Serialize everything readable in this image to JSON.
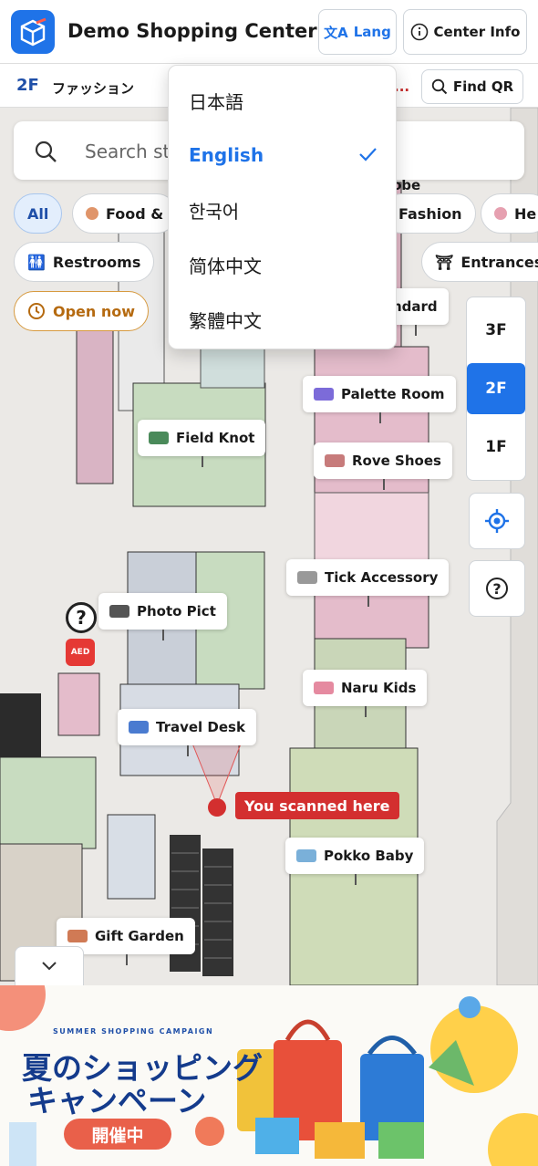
{
  "header": {
    "title": "Demo Shopping Center",
    "lang_label": "Lang",
    "center_info_label": "Center Info"
  },
  "floorbar": {
    "floor": "2F",
    "floor_name": "ファッション",
    "marquee": "...",
    "find_qr_label": "Find QR"
  },
  "search": {
    "placeholder": "Search sto"
  },
  "chips": {
    "all": "All",
    "food": "Food &",
    "fashion": "Fashion",
    "health": "He",
    "restrooms": "Restrooms",
    "entrances": "Entrances",
    "open_now": "Open now"
  },
  "language_menu": {
    "items": [
      {
        "label": "日本語"
      },
      {
        "label": "English",
        "selected": true
      },
      {
        "label": "한국어"
      },
      {
        "label": "简体中文"
      },
      {
        "label": "繁體中文"
      }
    ]
  },
  "floor_selector": {
    "floors": [
      "3F",
      "2F",
      "1F"
    ],
    "active": "2F"
  },
  "map": {
    "partial_labels": {
      "obe": "obe",
      "ndard": "ndard"
    },
    "stores": [
      {
        "name": "Palette Room"
      },
      {
        "name": "Field Knot"
      },
      {
        "name": "Rove Shoes"
      },
      {
        "name": "Tick Accessory"
      },
      {
        "name": "Photo Pict"
      },
      {
        "name": "Naru Kids"
      },
      {
        "name": "Travel Desk"
      },
      {
        "name": "Pokko Baby"
      },
      {
        "name": "Gift Garden"
      }
    ],
    "you_are_here": "You scanned here",
    "aed_label": "AED"
  },
  "banner": {
    "subtitle": "SUMMER SHOPPING CAMPAIGN",
    "line1": "夏のショッピング",
    "line2": "キャンペーン",
    "badge": "開催中"
  },
  "colors": {
    "accent": "#1f73e8",
    "active_floor": "#1f73e8",
    "scan_red": "#d32f2f",
    "food_dot": "#e0956a",
    "health_dot": "#e6a0b0"
  }
}
